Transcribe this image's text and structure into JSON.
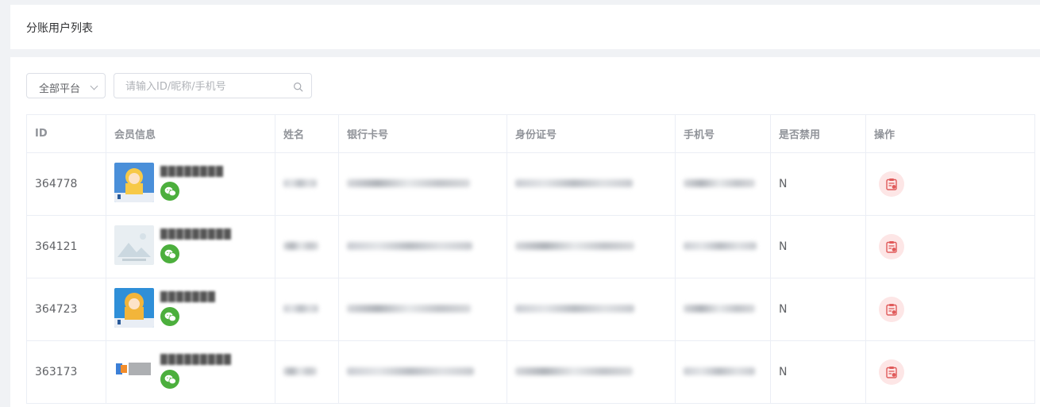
{
  "header": {
    "title": "分账用户列表"
  },
  "filters": {
    "platform_selected": "全部平台",
    "search_placeholder": "请输入ID/昵称/手机号"
  },
  "table": {
    "columns": [
      "ID",
      "会员信息",
      "姓名",
      "银行卡号",
      "身份证号",
      "手机号",
      "是否禁用",
      "操作"
    ],
    "rows": [
      {
        "id": "364778",
        "disabled": "N"
      },
      {
        "id": "364121",
        "disabled": "N"
      },
      {
        "id": "364723",
        "disabled": "N"
      },
      {
        "id": "363173",
        "disabled": "N"
      }
    ]
  },
  "colors": {
    "wechat_green": "#4caf3d",
    "action_bg": "#fde6e6",
    "action_icon": "#e05a5a"
  }
}
